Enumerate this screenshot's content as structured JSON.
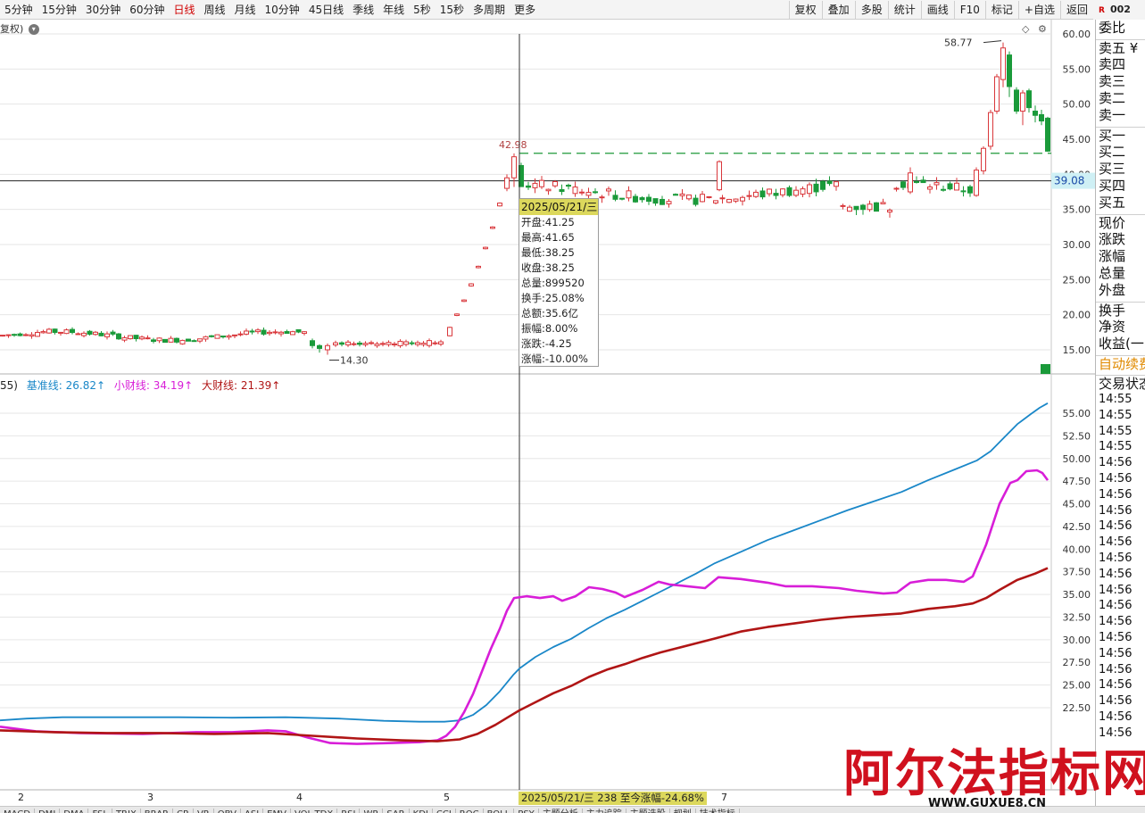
{
  "toolbar": {
    "periods": [
      "5分钟",
      "15分钟",
      "30分钟",
      "60分钟",
      "日线",
      "周线",
      "月线",
      "10分钟",
      "45日线",
      "季线",
      "年线",
      "5秒",
      "15秒",
      "多周期",
      "更多"
    ],
    "active_period": "日线",
    "tools": [
      "复权",
      "叠加",
      "多股",
      "统计",
      "画线",
      "F10",
      "标记",
      "+自选",
      "返回"
    ],
    "code_partial": "002"
  },
  "price_chart": {
    "fq_label": "复权",
    "y_ticks": [
      "60.00",
      "55.00",
      "50.00",
      "45.00",
      "40.00",
      "35.00",
      "30.00",
      "25.00",
      "20.00",
      "15.00"
    ],
    "y_min": 12.0,
    "y_max": 61.3,
    "current_price_label": "39.08",
    "high_label": "58.77",
    "low_label": "14.30",
    "crosshair_high_label": "42.98",
    "dashed_level": 43.0,
    "up_color": "#d9373b",
    "down_color": "#1a9a3a"
  },
  "tooltip": {
    "date": "2025/05/21/三",
    "rows": [
      "开盘:41.25",
      "最高:41.65",
      "最低:38.25",
      "收盘:38.25",
      "总量:899520",
      "换手:25.08%",
      "总额:35.6亿",
      "振幅:8.00%",
      "涨跌:-4.25",
      "涨幅:-10.00%"
    ]
  },
  "indicator_legend": {
    "prefix": "55)",
    "items": [
      {
        "label": "基准线: 26.82↑",
        "color": "#1a87c8"
      },
      {
        "label": "小财线: 34.19↑",
        "color": "#d81ed8"
      },
      {
        "label": "大财线: 21.39↑",
        "color": "#b01515"
      }
    ]
  },
  "chart_data": {
    "type": "line",
    "title": "",
    "ylim": [
      20.4,
      59.0
    ],
    "y_ticks": [
      "55.00",
      "52.50",
      "50.00",
      "47.50",
      "45.00",
      "42.50",
      "40.00",
      "37.50",
      "35.00",
      "32.50",
      "30.00",
      "27.50",
      "25.00",
      "22.50"
    ],
    "series": [
      {
        "name": "基准线",
        "color": "#1a87c8",
        "values": [
          [
            0,
            21.1
          ],
          [
            30,
            21.3
          ],
          [
            70,
            21.45
          ],
          [
            130,
            21.45
          ],
          [
            200,
            21.45
          ],
          [
            260,
            21.4
          ],
          [
            320,
            21.45
          ],
          [
            380,
            21.3
          ],
          [
            430,
            21.05
          ],
          [
            470,
            20.95
          ],
          [
            498,
            20.95
          ],
          [
            515,
            21.1
          ],
          [
            530,
            21.7
          ],
          [
            545,
            22.8
          ],
          [
            560,
            24.3
          ],
          [
            575,
            26.1
          ],
          [
            582,
            26.82
          ],
          [
            600,
            28.1
          ],
          [
            620,
            29.2
          ],
          [
            640,
            30.1
          ],
          [
            660,
            31.3
          ],
          [
            680,
            32.4
          ],
          [
            700,
            33.3
          ],
          [
            720,
            34.3
          ],
          [
            740,
            35.3
          ],
          [
            760,
            36.3
          ],
          [
            780,
            37.3
          ],
          [
            800,
            38.4
          ],
          [
            830,
            39.7
          ],
          [
            860,
            41.0
          ],
          [
            890,
            42.1
          ],
          [
            920,
            43.2
          ],
          [
            950,
            44.3
          ],
          [
            980,
            45.3
          ],
          [
            1010,
            46.3
          ],
          [
            1040,
            47.6
          ],
          [
            1070,
            48.8
          ],
          [
            1095,
            49.8
          ],
          [
            1110,
            50.8
          ],
          [
            1125,
            52.3
          ],
          [
            1140,
            53.8
          ],
          [
            1155,
            54.9
          ],
          [
            1165,
            55.6
          ],
          [
            1174,
            56.1
          ]
        ]
      },
      {
        "name": "小财线",
        "color": "#d81ed8",
        "values": [
          [
            0,
            20.4
          ],
          [
            40,
            19.9
          ],
          [
            90,
            19.7
          ],
          [
            160,
            19.6
          ],
          [
            220,
            19.8
          ],
          [
            260,
            19.8
          ],
          [
            300,
            20.0
          ],
          [
            320,
            19.9
          ],
          [
            345,
            19.2
          ],
          [
            370,
            18.6
          ],
          [
            400,
            18.5
          ],
          [
            440,
            18.6
          ],
          [
            470,
            18.7
          ],
          [
            490,
            18.9
          ],
          [
            500,
            19.4
          ],
          [
            510,
            20.4
          ],
          [
            520,
            22.0
          ],
          [
            530,
            24.0
          ],
          [
            540,
            26.5
          ],
          [
            550,
            29.0
          ],
          [
            560,
            31.2
          ],
          [
            568,
            33.2
          ],
          [
            576,
            34.6
          ],
          [
            590,
            34.8
          ],
          [
            605,
            34.6
          ],
          [
            620,
            34.8
          ],
          [
            630,
            34.3
          ],
          [
            645,
            34.8
          ],
          [
            660,
            35.8
          ],
          [
            675,
            35.6
          ],
          [
            690,
            35.2
          ],
          [
            700,
            34.7
          ],
          [
            720,
            35.5
          ],
          [
            738,
            36.4
          ],
          [
            750,
            36.1
          ],
          [
            770,
            35.9
          ],
          [
            790,
            35.7
          ],
          [
            805,
            36.9
          ],
          [
            830,
            36.7
          ],
          [
            860,
            36.3
          ],
          [
            880,
            35.9
          ],
          [
            910,
            35.9
          ],
          [
            940,
            35.7
          ],
          [
            960,
            35.4
          ],
          [
            990,
            35.1
          ],
          [
            1005,
            35.2
          ],
          [
            1020,
            36.3
          ],
          [
            1040,
            36.6
          ],
          [
            1060,
            36.6
          ],
          [
            1080,
            36.4
          ],
          [
            1090,
            37.0
          ],
          [
            1105,
            40.5
          ],
          [
            1120,
            45.0
          ],
          [
            1132,
            47.3
          ],
          [
            1140,
            47.6
          ],
          [
            1150,
            48.6
          ],
          [
            1162,
            48.7
          ],
          [
            1168,
            48.4
          ],
          [
            1174,
            47.6
          ]
        ]
      },
      {
        "name": "大财线",
        "color": "#b01515",
        "values": [
          [
            0,
            20.0
          ],
          [
            60,
            19.8
          ],
          [
            120,
            19.7
          ],
          [
            180,
            19.7
          ],
          [
            240,
            19.6
          ],
          [
            300,
            19.7
          ],
          [
            350,
            19.4
          ],
          [
            400,
            19.1
          ],
          [
            450,
            18.9
          ],
          [
            490,
            18.8
          ],
          [
            515,
            19.0
          ],
          [
            535,
            19.6
          ],
          [
            555,
            20.6
          ],
          [
            570,
            21.5
          ],
          [
            582,
            22.2
          ],
          [
            600,
            23.1
          ],
          [
            620,
            24.1
          ],
          [
            640,
            24.9
          ],
          [
            660,
            25.9
          ],
          [
            680,
            26.7
          ],
          [
            700,
            27.3
          ],
          [
            720,
            28.0
          ],
          [
            740,
            28.6
          ],
          [
            760,
            29.1
          ],
          [
            780,
            29.6
          ],
          [
            800,
            30.1
          ],
          [
            830,
            30.9
          ],
          [
            860,
            31.4
          ],
          [
            890,
            31.8
          ],
          [
            920,
            32.2
          ],
          [
            950,
            32.5
          ],
          [
            980,
            32.7
          ],
          [
            1010,
            32.9
          ],
          [
            1040,
            33.4
          ],
          [
            1070,
            33.7
          ],
          [
            1090,
            34.0
          ],
          [
            1105,
            34.6
          ],
          [
            1120,
            35.5
          ],
          [
            1140,
            36.6
          ],
          [
            1160,
            37.3
          ],
          [
            1174,
            37.9
          ]
        ]
      }
    ]
  },
  "date_strip": {
    "ticks": [
      {
        "x": 20,
        "label": "2"
      },
      {
        "x": 165,
        "label": "3"
      },
      {
        "x": 332,
        "label": "4"
      },
      {
        "x": 497,
        "label": "5"
      },
      {
        "x": 808,
        "label": "7"
      }
    ],
    "crosshair_info": "2025/05/21/三 238 至今涨幅-24.68%"
  },
  "right_panel": {
    "items": [
      "委比",
      "卖五 ¥",
      "卖四",
      "卖三",
      "卖二",
      "卖一",
      "买一",
      "买二",
      "买三",
      "买四",
      "买五",
      "现价",
      "涨跌",
      "涨幅",
      "总量",
      "外盘",
      "换手",
      "净资",
      "收益(一)"
    ],
    "auto_label": "自动续费",
    "trade_title": "交易状态",
    "times": [
      "14:55",
      "14:55",
      "14:55",
      "14:55",
      "14:56",
      "14:56",
      "14:56",
      "14:56",
      "14:56",
      "14:56",
      "14:56",
      "14:56",
      "14:56",
      "14:56",
      "14:56",
      "14:56",
      "14:56",
      "14:56",
      "14:56",
      "14:56",
      "14:56",
      "14:56"
    ]
  },
  "bottom_tabs": [
    "MACD",
    "DMI",
    "DMA",
    "FSL",
    "TRIX",
    "BRAR",
    "CR",
    "VR",
    "OBV",
    "ASI",
    "EMV",
    "VOL-TDX",
    "RSI",
    "WR",
    "SAR",
    "KDJ",
    "CCI",
    "ROC",
    "BOLL",
    "PSY",
    "主题分析",
    "主力追踪",
    "主题选股",
    "规划",
    "技术指标"
  ],
  "watermark": {
    "main": "阿尔法指标网",
    "url": "WWW.GUXUE8.CN"
  }
}
